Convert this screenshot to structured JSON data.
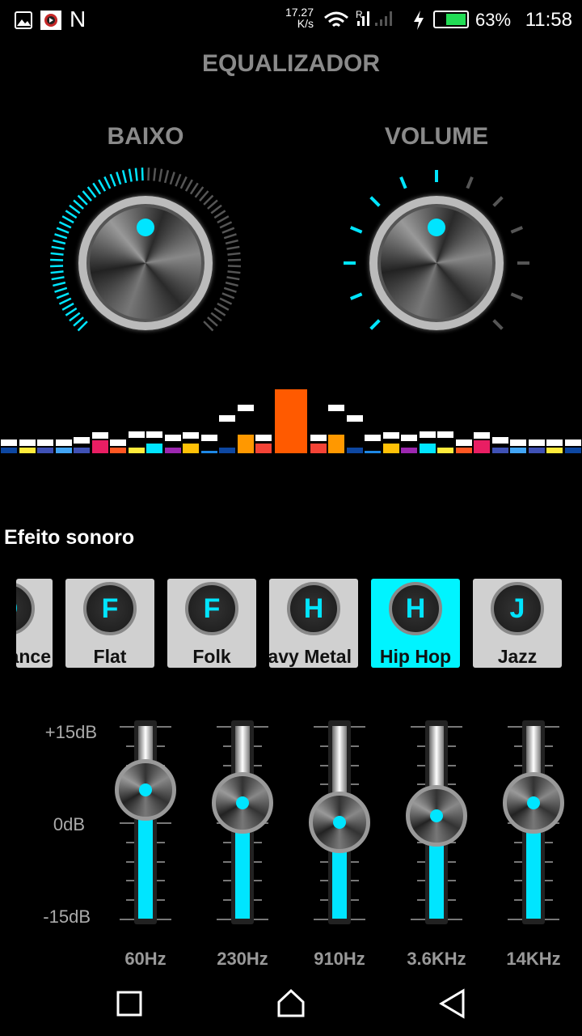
{
  "status": {
    "net_speed": "17.27",
    "net_unit": "K/s",
    "battery": "63%",
    "battery_level": 63,
    "time": "11:58",
    "notif_n": "N",
    "icons": [
      "image-icon",
      "video-app-icon",
      "wifi-icon",
      "signal-icon",
      "charging-icon",
      "battery-icon"
    ]
  },
  "title": "EQUALIZADOR",
  "bass": {
    "label": "BAIXO",
    "level": 0.5
  },
  "volume": {
    "label": "VOLUME",
    "level": 0.5
  },
  "visualizer": {
    "levels": [
      9,
      9,
      9,
      9,
      9,
      20,
      9,
      9,
      15,
      9,
      15,
      4,
      9,
      29,
      15,
      100,
      15,
      29,
      9,
      4,
      15,
      9,
      15,
      9,
      9,
      20,
      9,
      9,
      9,
      9,
      9
    ],
    "peaks": [
      21,
      21,
      21,
      21,
      25,
      33,
      21,
      34,
      34,
      29,
      33,
      29,
      59,
      76,
      29,
      100,
      29,
      76,
      59,
      29,
      33,
      29,
      34,
      34,
      21,
      33,
      25,
      21,
      21,
      21,
      21
    ],
    "colors": [
      "#0d47a1",
      "#ffeb3b",
      "#3f51b5",
      "#42a5f5",
      "#3f51b5",
      "#e91e63",
      "#ff5722",
      "#ffeb3b",
      "#00e5ff",
      "#9c27b0",
      "#ffc107",
      "#1e88e5",
      "#0d47a1",
      "#ff9800",
      "#f44336",
      "#ff5a00",
      "#f44336",
      "#ff9800",
      "#0d47a1",
      "#1e88e5",
      "#ffc107",
      "#9c27b0",
      "#00e5ff",
      "#ffeb3b",
      "#ff5722",
      "#e91e63",
      "#3f51b5",
      "#42a5f5",
      "#3f51b5",
      "#ffeb3b",
      "#0d47a1"
    ]
  },
  "section_title": "Efeito sonoro",
  "presets": [
    {
      "label": "Dance",
      "letter": "D"
    },
    {
      "label": "Flat",
      "letter": "F"
    },
    {
      "label": "Folk",
      "letter": "F"
    },
    {
      "label": "Heavy Metal",
      "letter": "H"
    },
    {
      "label": "Hip Hop",
      "letter": "H",
      "active": true
    },
    {
      "label": "Jazz",
      "letter": "J"
    }
  ],
  "eq": {
    "max_label": "+15dB",
    "mid_label": "0dB",
    "min_label": "-15dB",
    "range": [
      -15,
      15
    ],
    "bands": [
      {
        "label": "60Hz",
        "gain": 5
      },
      {
        "label": "230Hz",
        "gain": 3
      },
      {
        "label": "910Hz",
        "gain": 0
      },
      {
        "label": "3.6KHz",
        "gain": 1
      },
      {
        "label": "14KHz",
        "gain": 3
      }
    ]
  },
  "accent": "#00e5ff"
}
